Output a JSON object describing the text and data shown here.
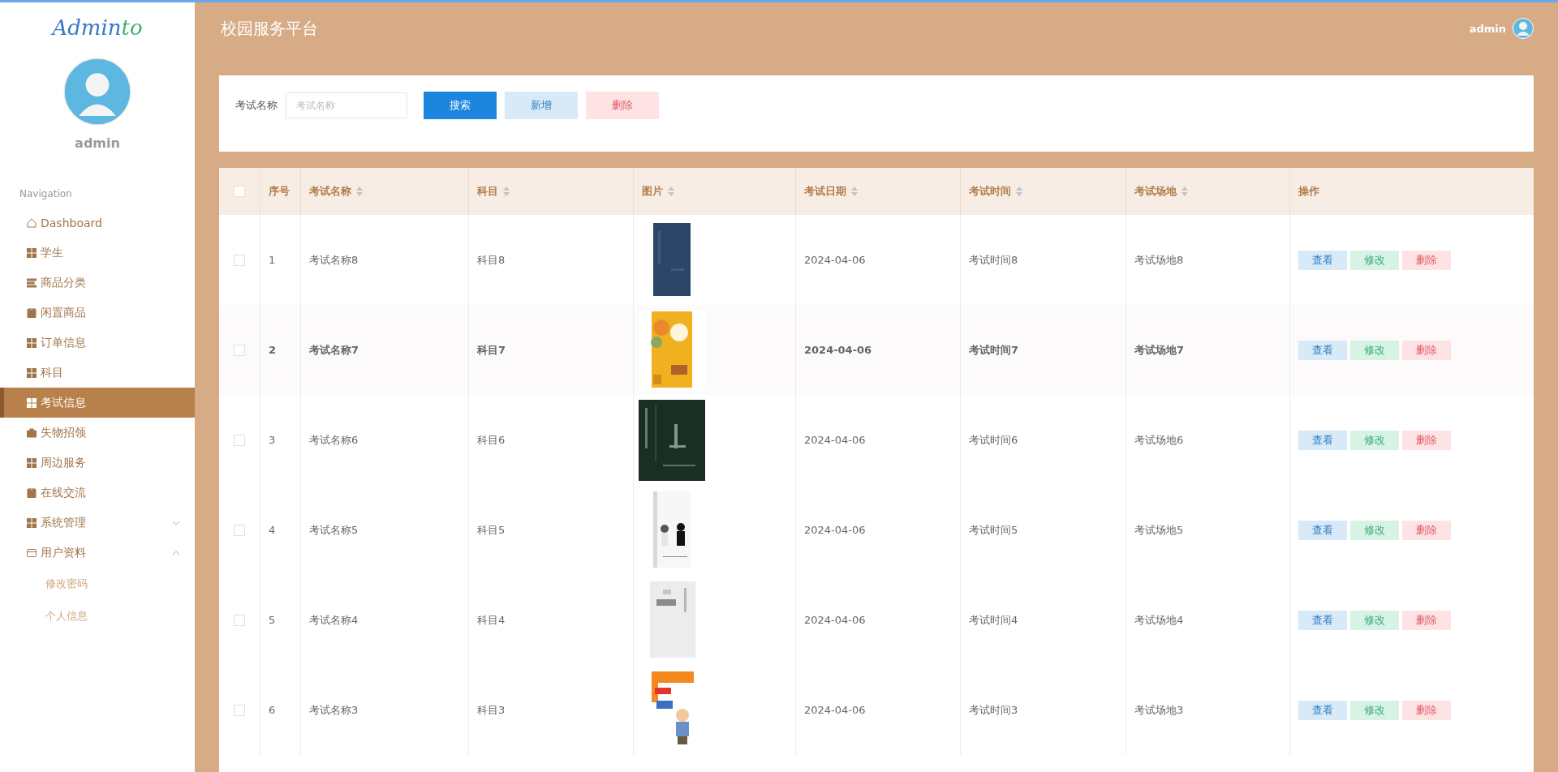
{
  "sidebar": {
    "logo": {
      "text": "Admin",
      "accent": "to"
    },
    "username": "admin",
    "nav_heading": "Navigation",
    "items": [
      {
        "label": "Dashboard",
        "kind": "link",
        "selected": false
      },
      {
        "label": "学生",
        "kind": "link",
        "selected": false
      },
      {
        "label": "商品分类",
        "kind": "link",
        "selected": false
      },
      {
        "label": "闲置商品",
        "kind": "link",
        "selected": false
      },
      {
        "label": "订单信息",
        "kind": "link",
        "selected": false
      },
      {
        "label": "科目",
        "kind": "link",
        "selected": false
      },
      {
        "label": "考试信息",
        "kind": "link",
        "selected": true
      },
      {
        "label": "失物招领",
        "kind": "link",
        "selected": false
      },
      {
        "label": "周边服务",
        "kind": "link",
        "selected": false
      },
      {
        "label": "在线交流",
        "kind": "link",
        "selected": false
      },
      {
        "label": "系统管理",
        "kind": "group",
        "selected": false,
        "expanded": false
      },
      {
        "label": "用户资料",
        "kind": "group",
        "selected": false,
        "expanded": true,
        "children": [
          {
            "label": "修改密码",
            "selected": false
          },
          {
            "label": "个人信息",
            "selected": false
          }
        ]
      }
    ]
  },
  "header": {
    "title": "校园服务平台",
    "user": "admin"
  },
  "search": {
    "label": "考试名称",
    "placeholder": "考试名称",
    "buttons": [
      {
        "label": "搜索",
        "kind": "primary"
      },
      {
        "label": "新增",
        "kind": "info"
      },
      {
        "label": "删除",
        "kind": "danger"
      }
    ]
  },
  "table": {
    "select_all_checked": false,
    "columns": [
      {
        "label": "序号",
        "sortable": false
      },
      {
        "label": "考试名称",
        "sortable": true
      },
      {
        "label": "科目",
        "sortable": true
      },
      {
        "label": "图片",
        "sortable": true,
        "kind": "picture"
      },
      {
        "label": "考试日期",
        "sortable": true
      },
      {
        "label": "考试时间",
        "sortable": true
      },
      {
        "label": "考试场地",
        "sortable": true
      },
      {
        "label": "操作",
        "sortable": false
      }
    ],
    "rows": [
      {
        "checked": false,
        "highlighted": false,
        "cells": [
          "1",
          "考试名称8",
          "科目8",
          "",
          "2024-04-06",
          "考试时间8",
          "考试场地8"
        ],
        "actions": [
          {
            "label": "查看",
            "kind": "view"
          },
          {
            "label": "修改",
            "kind": "edit"
          },
          {
            "label": "删除",
            "kind": "delete"
          }
        ]
      },
      {
        "checked": false,
        "highlighted": true,
        "cells": [
          "2",
          "考试名称7",
          "科目7",
          "",
          "2024-04-06",
          "考试时间7",
          "考试场地7"
        ],
        "actions": [
          {
            "label": "查看",
            "kind": "view"
          },
          {
            "label": "修改",
            "kind": "edit"
          },
          {
            "label": "删除",
            "kind": "delete"
          }
        ]
      },
      {
        "checked": false,
        "highlighted": false,
        "cells": [
          "3",
          "考试名称6",
          "科目6",
          "",
          "2024-04-06",
          "考试时间6",
          "考试场地6"
        ],
        "actions": [
          {
            "label": "查看",
            "kind": "view"
          },
          {
            "label": "修改",
            "kind": "edit"
          },
          {
            "label": "删除",
            "kind": "delete"
          }
        ]
      },
      {
        "checked": false,
        "highlighted": false,
        "cells": [
          "4",
          "考试名称5",
          "科目5",
          "",
          "2024-04-06",
          "考试时间5",
          "考试场地5"
        ],
        "actions": [
          {
            "label": "查看",
            "kind": "view"
          },
          {
            "label": "修改",
            "kind": "edit"
          },
          {
            "label": "删除",
            "kind": "delete"
          }
        ]
      },
      {
        "checked": false,
        "highlighted": false,
        "cells": [
          "5",
          "考试名称4",
          "科目4",
          "",
          "2024-04-06",
          "考试时间4",
          "考试场地4"
        ],
        "actions": [
          {
            "label": "查看",
            "kind": "view"
          },
          {
            "label": "修改",
            "kind": "edit"
          },
          {
            "label": "删除",
            "kind": "delete"
          }
        ]
      },
      {
        "checked": false,
        "highlighted": false,
        "cells": [
          "6",
          "考试名称3",
          "科目3",
          "",
          "2024-04-06",
          "考试时间3",
          "考试场地3"
        ],
        "actions": [
          {
            "label": "查看",
            "kind": "view"
          },
          {
            "label": "修改",
            "kind": "edit"
          },
          {
            "label": "删除",
            "kind": "delete"
          }
        ]
      }
    ]
  }
}
